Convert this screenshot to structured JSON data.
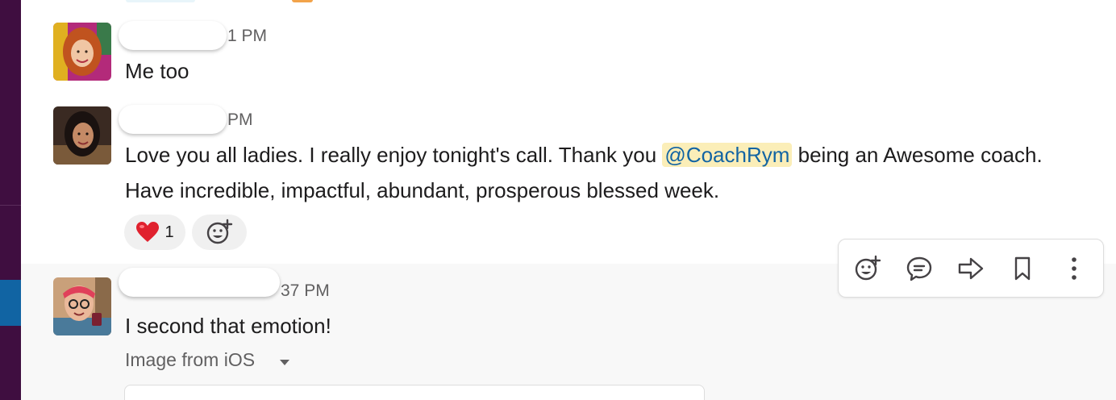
{
  "messages": [
    {
      "avatar": "avatar-red-hair-woman",
      "time": "1 PM",
      "text": "Me too"
    },
    {
      "avatar": "avatar-dark-hair-woman",
      "time": "PM",
      "text_before": "Love you all ladies. I really enjoy tonight's call. Thank you ",
      "mention": "@CoachRym",
      "text_after": " being an Awesome coach. Have incredible, impactful, abundant, prosperous blessed week.",
      "reactions": [
        {
          "emoji": "❤️",
          "icon": "red-heart-emoji",
          "count": "1"
        }
      ],
      "add_reaction_icon": "add-emoji-icon"
    },
    {
      "avatar": "avatar-woman-headband-glasses",
      "time": "37 PM",
      "text": "I second that emotion!",
      "attachment_label": "Image from iOS"
    }
  ],
  "message_toolbar": {
    "buttons": [
      {
        "icon": "add-reaction-icon"
      },
      {
        "icon": "reply-thread-icon"
      },
      {
        "icon": "forward-arrow-icon"
      },
      {
        "icon": "bookmark-icon"
      },
      {
        "icon": "more-actions-icon"
      }
    ]
  },
  "colors": {
    "sidebar": "#3f0e40",
    "active_workspace": "#1164a3",
    "mention_bg": "#fbeeb8",
    "mention_text": "#1264a3",
    "hover_bg": "#f8f8f8"
  }
}
